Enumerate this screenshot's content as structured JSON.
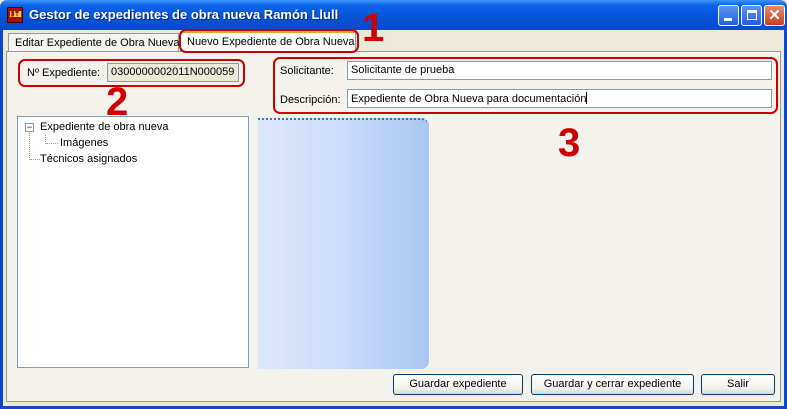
{
  "window": {
    "title": "Gestor de expedientes de obra nueva Ramón Llull",
    "icon": "llull-app-icon",
    "icon_text": "Llull"
  },
  "tabs": [
    {
      "label": "Editar Expediente de Obra Nueva",
      "selected": false
    },
    {
      "label": "Nuevo Expediente de Obra Nueva",
      "selected": true
    }
  ],
  "form": {
    "expediente_label": "Nº Expediente:",
    "expediente_value": "0300000002011N000059",
    "solicitante_label": "Solicitante:",
    "solicitante_value": "Solicitante de prueba",
    "descripcion_label": "Descripción:",
    "descripcion_value": "Expediente de Obra Nueva para documentación"
  },
  "tree": {
    "root": "Expediente de obra nueva",
    "children": [
      "Imágenes"
    ],
    "sibling": "Técnicos asignados"
  },
  "buttons": {
    "save": "Guardar expediente",
    "save_close": "Guardar y cerrar expediente",
    "exit": "Salir"
  },
  "annotations": [
    "1",
    "2",
    "3"
  ],
  "colors": {
    "annotation": "#cc0000",
    "titlebar": "#0653d6",
    "panel_blue": "#c9dcf9"
  }
}
